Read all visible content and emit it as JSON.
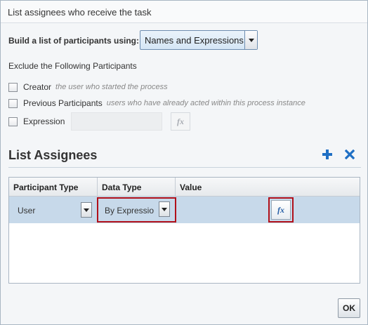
{
  "dialog": {
    "title": "List assignees who receive the task"
  },
  "build": {
    "label": "Build a list of participants using:",
    "selected": "Names and Expressions"
  },
  "exclude": {
    "label": "Exclude the Following Participants",
    "options": [
      {
        "label": "Creator",
        "hint": "the user who started the process",
        "checked": false
      },
      {
        "label": "Previous Participants",
        "hint": "users who have already acted within this process instance",
        "checked": false
      },
      {
        "label": "Expression",
        "hint": "",
        "checked": false
      }
    ],
    "expression_fx": "fx"
  },
  "assignees": {
    "title": "List Assignees",
    "add_icon": "plus-icon",
    "remove_icon": "x-icon",
    "columns": [
      "Participant Type",
      "Data Type",
      "Value"
    ],
    "rows": [
      {
        "participant_type": "User",
        "data_type": "By Expressio",
        "value_fx": "fx"
      }
    ]
  },
  "footer": {
    "ok_label": "OK"
  },
  "colors": {
    "accent": "#1f6fc4",
    "selected_row": "#c7d9ea",
    "highlight_box": "#b1101a"
  }
}
